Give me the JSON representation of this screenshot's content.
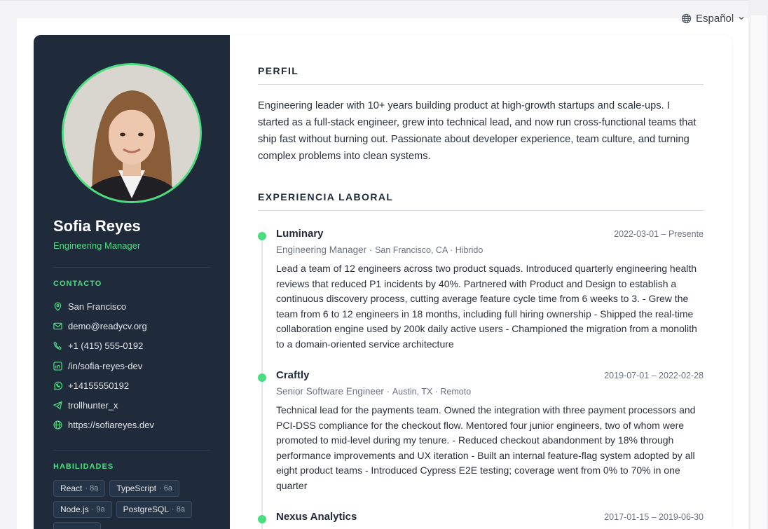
{
  "language_selector": {
    "label": "Español",
    "icon": "globe-icon"
  },
  "sidebar": {
    "name": "Sofia Reyes",
    "title": "Engineering Manager",
    "contact_heading": "CONTACTO",
    "contact": [
      {
        "icon": "location-pin-icon",
        "text": "San Francisco"
      },
      {
        "icon": "mail-icon",
        "text": "demo@readycv.org"
      },
      {
        "icon": "phone-icon",
        "text": "+1 (415) 555-0192"
      },
      {
        "icon": "linkedin-icon",
        "text": "/in/sofia-reyes-dev"
      },
      {
        "icon": "whatsapp-icon",
        "text": "+14155550192"
      },
      {
        "icon": "telegram-icon",
        "text": "trollhunter_x"
      },
      {
        "icon": "globe-icon",
        "text": "https://sofiareyes.dev"
      }
    ],
    "skills_heading": "HABILIDADES",
    "skills": [
      {
        "name": "React",
        "level": "8a"
      },
      {
        "name": "TypeScript",
        "level": "6a"
      },
      {
        "name": "Node.js",
        "level": "9a"
      },
      {
        "name": "PostgreSQL",
        "level": "8a"
      }
    ]
  },
  "main": {
    "profile_heading": "PERFIL",
    "profile_text": "Engineering leader with 10+ years building product at high-growth startups and scale-ups. I started as a full-stack engineer, grew into technical lead, and now run cross-functional teams that ship fast without burning out. Passionate about developer experience, team culture, and turning complex problems into clean systems.",
    "experience_heading": "EXPERIENCIA LABORAL",
    "jobs": [
      {
        "company": "Luminary",
        "dates": "2022-03-01 – Presente",
        "role": "Engineering Manager",
        "location": "San Francisco, CA · Hibrido",
        "description": "Lead a team of 12 engineers across two product squads. Introduced quarterly engineering health reviews that reduced P1 incidents by 40%. Partnered with Product and Design to establish a continuous discovery process, cutting average feature cycle time from 6 weeks to 3. - Grew the team from 6 to 12 engineers in 18 months, including full hiring ownership - Shipped the real-time collaboration engine used by 200k daily active users - Championed the migration from a monolith to a domain-oriented service architecture"
      },
      {
        "company": "Craftly",
        "dates": "2019-07-01 – 2022-02-28",
        "role": "Senior Software Engineer",
        "location": "Austin, TX · Remoto",
        "description": "Technical lead for the payments team. Owned the integration with three payment processors and PCI-DSS compliance for the checkout flow. Mentored four junior engineers, two of whom were promoted to mid-level during my tenure. - Reduced checkout abandonment by 18% through performance improvements and UX iteration - Built an internal feature-flag system adopted by all eight product teams - Introduced Cypress E2E testing; coverage went from 0% to 70% in one quarter"
      },
      {
        "company": "Nexus Analytics",
        "dates": "2017-01-15 – 2019-06-30",
        "role": "",
        "location": "",
        "description": ""
      }
    ]
  },
  "colors": {
    "sidebar_bg": "#1f2a3a",
    "accent": "#4ade80"
  }
}
